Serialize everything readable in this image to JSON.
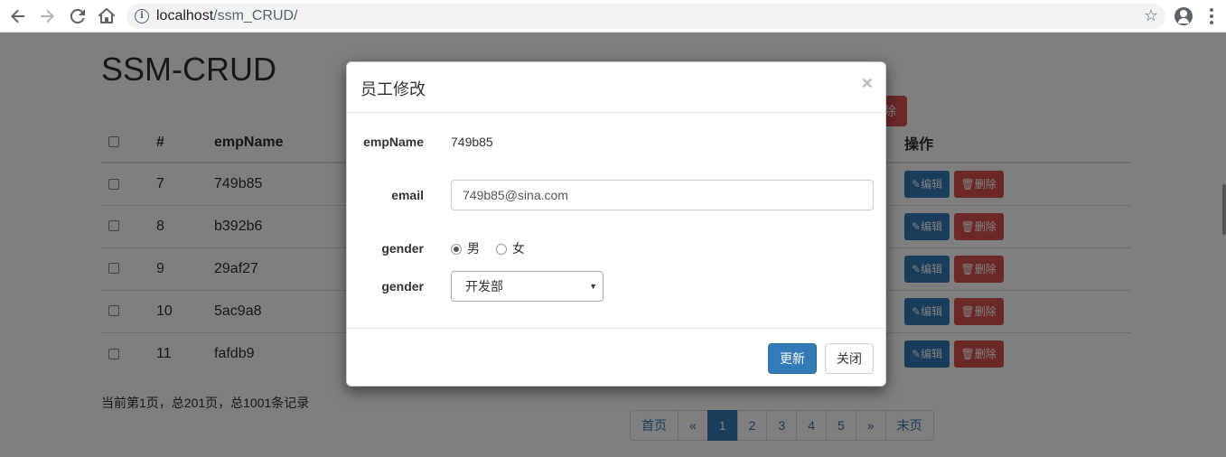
{
  "browser": {
    "url_host": "localhost",
    "url_path": "/ssm_CRUD/"
  },
  "page": {
    "title": "SSM-CRUD",
    "top_delete_label": "除",
    "table": {
      "headers": [
        "#",
        "empName",
        "操作"
      ],
      "rows": [
        {
          "id": "7",
          "name": "749b85"
        },
        {
          "id": "8",
          "name": "b392b6"
        },
        {
          "id": "9",
          "name": "29af27"
        },
        {
          "id": "10",
          "name": "5ac9a8"
        },
        {
          "id": "11",
          "name": "fafdb9"
        }
      ],
      "edit_label": "编辑",
      "delete_label": "删除"
    },
    "footer_info": "当前第1页，总201页，总1001条记录",
    "pagination": [
      "首页",
      "«",
      "1",
      "2",
      "3",
      "4",
      "5",
      "»",
      "末页"
    ],
    "pagination_active": "1"
  },
  "modal": {
    "title": "员工修改",
    "close_glyph": "×",
    "empname_label": "empName",
    "empname_value": "749b85",
    "email_label": "email",
    "email_value": "749b85@sina.com",
    "gender_label": "gender",
    "gender_options": [
      "男",
      "女"
    ],
    "gender_selected": "男",
    "dept_label": "gender",
    "dept_value": "开发部",
    "update_button": "更新",
    "close_button": "关闭"
  }
}
